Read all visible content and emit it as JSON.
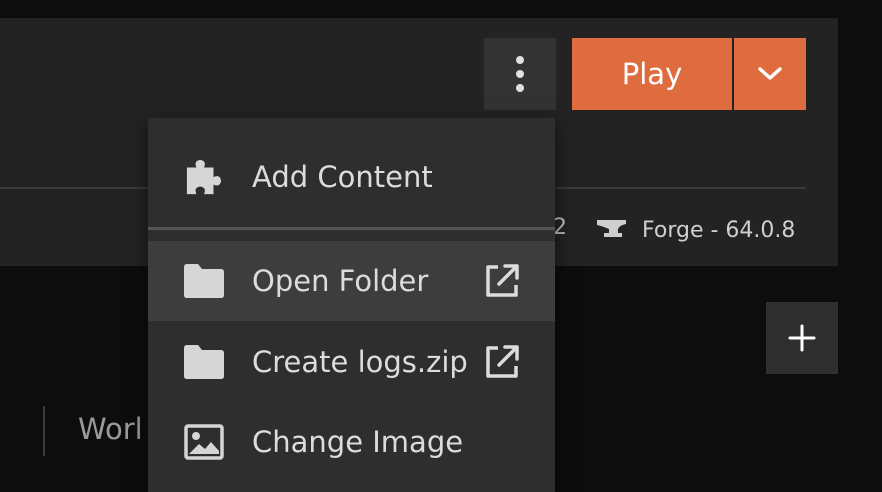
{
  "header": {
    "play_label": "Play",
    "version_stub": "2",
    "loader_label": "Forge - 64.0.8"
  },
  "tabs": {
    "worlds_label": "Worl"
  },
  "menu": {
    "items": [
      {
        "label": "Add Content",
        "icon": "puzzle-icon",
        "external": false
      },
      {
        "label": "Open Folder",
        "icon": "folder-icon",
        "external": true
      },
      {
        "label": "Create logs.zip",
        "icon": "folder-icon",
        "external": true
      },
      {
        "label": "Change Image",
        "icon": "image-icon",
        "external": false
      }
    ]
  },
  "colors": {
    "accent": "#df6c3e",
    "panel": "#232323",
    "menu": "#2e2e2e",
    "menu_hover": "#3d3d3d",
    "background": "#0d0d0d"
  }
}
